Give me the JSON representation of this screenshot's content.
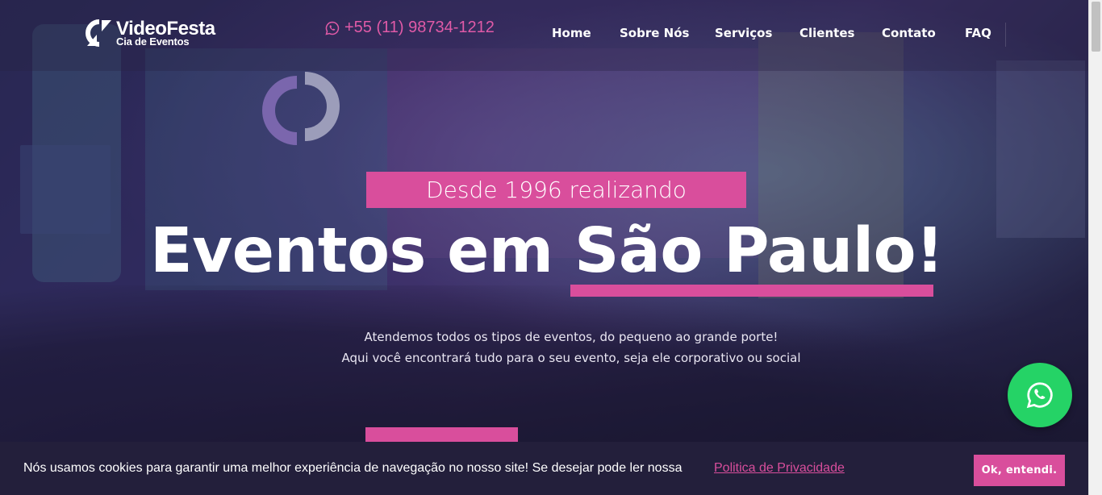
{
  "brand": {
    "name_line1": "VideoFesta",
    "name_line2": "Cia de Eventos"
  },
  "header": {
    "phone": "+55 (11) 98734-1212"
  },
  "nav": {
    "items": [
      "Home",
      "Sobre Nós",
      "Serviços",
      "Clientes",
      "Contato",
      "FAQ"
    ]
  },
  "hero": {
    "badge": "Desde 1996 realizando",
    "headline": "Eventos em São Paulo!",
    "subtitle_line1": "Atendemos todos os tipos de eventos, do pequeno ao grande porte!",
    "subtitle_line2": "Aqui você encontrará tudo para o seu evento, seja ele corporativo ou social"
  },
  "cookie": {
    "message": "Nós usamos cookies para garantir uma melhor experiência de navegação no nosso site! Se desejar pode ler nossa",
    "link": "Politica de Privacidade",
    "button": "Ok, entendi."
  },
  "colors": {
    "accent": "#d94e9c",
    "whatsapp": "#25d366",
    "cookie_bar": "#231f3b"
  },
  "icons": {
    "phone": "whatsapp-icon",
    "floating": "whatsapp-icon"
  }
}
